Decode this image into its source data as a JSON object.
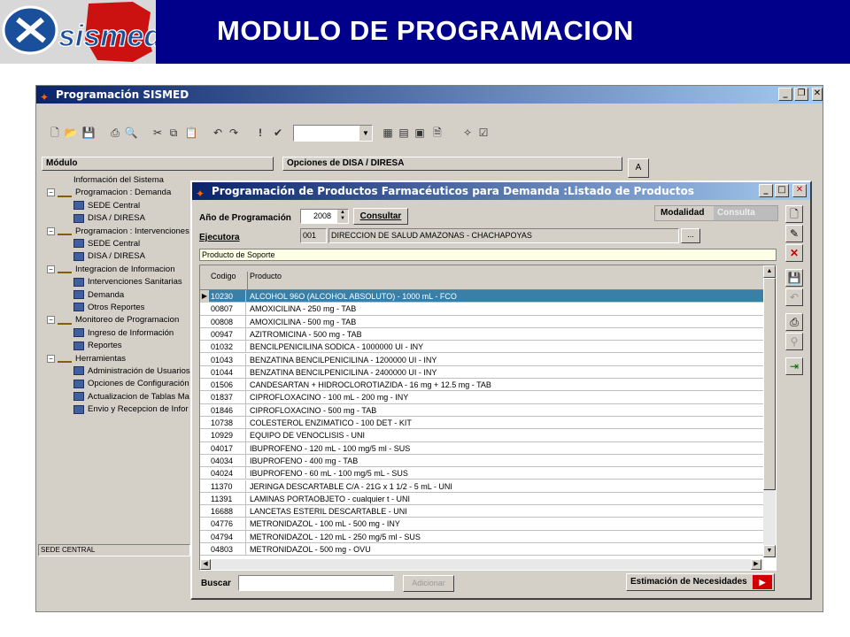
{
  "slide": {
    "title": "MODULO DE PROGRAMACION",
    "logo_text": "sismed"
  },
  "main_window": {
    "title": "Programación SISMED",
    "panel_left_header": "Módulo",
    "panel_right_header": "Opciones de DISA / DIRESA",
    "a_button": "A",
    "status_text": "SEDE CENTRAL",
    "tree": [
      {
        "label": "Información del Sistema",
        "level": 1
      },
      {
        "label": "Programacion : Demanda",
        "level": 0
      },
      {
        "label": "SEDE Central",
        "level": 2
      },
      {
        "label": "DISA / DIRESA",
        "level": 2
      },
      {
        "label": "Programacion : Intervenciones S",
        "level": 0
      },
      {
        "label": "SEDE Central",
        "level": 2
      },
      {
        "label": "DISA / DIRESA",
        "level": 2
      },
      {
        "label": "Integracion de Informacion",
        "level": 0
      },
      {
        "label": "Intervenciones Sanitarias",
        "level": 2
      },
      {
        "label": "Demanda",
        "level": 2
      },
      {
        "label": "Otros Reportes",
        "level": 2
      },
      {
        "label": "Monitoreo de Programacion",
        "level": 0
      },
      {
        "label": "Ingreso de Información",
        "level": 2
      },
      {
        "label": "Reportes",
        "level": 2
      },
      {
        "label": "Herramientas",
        "level": 0
      },
      {
        "label": "Administración de Usuarios",
        "level": 2
      },
      {
        "label": "Opciones de Configuración",
        "level": 2
      },
      {
        "label": "Actualizacion de Tablas Ma",
        "level": 2
      },
      {
        "label": "Envio y Recepcion de Infor",
        "level": 2
      }
    ]
  },
  "dialog": {
    "title": "Programación de Productos Farmacéuticos para Demanda :Listado de Productos",
    "year_label": "Año de Programación",
    "year_value": "2008",
    "consultar_label": "Consultar",
    "modalidad_label": "Modalidad",
    "modalidad_value": "Consulta",
    "ejecutora_label": "Ejecutora",
    "ejecutora_code": "001",
    "ejecutora_name": "DIRECCION DE SALUD AMAZONAS - CHACHAPOYAS",
    "browse_label": "...",
    "soporte_label": "Producto de Soporte",
    "col_codigo": "Codigo",
    "col_producto": "Producto",
    "buscar_label": "Buscar",
    "buscar_value": "",
    "adicionar_label": "Adicionar",
    "estimacion_label": "Estimación de Necesidades",
    "rows": [
      {
        "code": "10230",
        "product": "ALCOHOL 96O (ALCOHOL ABSOLUTO) - 1000 mL - FCO"
      },
      {
        "code": "00807",
        "product": "AMOXICILINA - 250 mg - TAB"
      },
      {
        "code": "00808",
        "product": "AMOXICILINA - 500 mg - TAB"
      },
      {
        "code": "00947",
        "product": "AZITROMICINA - 500 mg - TAB"
      },
      {
        "code": "01032",
        "product": "BENCILPENICILINA SODICA - 1000000 UI - INY"
      },
      {
        "code": "01043",
        "product": "BENZATINA BENCILPENICILINA - 1200000 UI - INY"
      },
      {
        "code": "01044",
        "product": "BENZATINA BENCILPENICILINA - 2400000 UI - INY"
      },
      {
        "code": "01506",
        "product": "CANDESARTAN + HIDROCLOROTIAZIDA - 16 mg + 12.5 mg - TAB"
      },
      {
        "code": "01837",
        "product": "CIPROFLOXACINO - 100 mL - 200 mg - INY"
      },
      {
        "code": "01846",
        "product": "CIPROFLOXACINO - 500 mg - TAB"
      },
      {
        "code": "10738",
        "product": "COLESTEROL ENZIMATICO - 100 DET - KIT"
      },
      {
        "code": "10929",
        "product": "EQUIPO DE VENOCLISIS - UNI"
      },
      {
        "code": "04017",
        "product": "IBUPROFENO - 120 mL - 100 mg/5 ml - SUS"
      },
      {
        "code": "04034",
        "product": "IBUPROFENO - 400 mg - TAB"
      },
      {
        "code": "04024",
        "product": "IBUPROFENO - 60 mL - 100 mg/5 mL - SUS"
      },
      {
        "code": "11370",
        "product": "JERINGA DESCARTABLE C/A - 21G x 1 1/2 - 5 mL - UNI"
      },
      {
        "code": "11391",
        "product": "LAMINAS PORTAOBJETO - cualquier t - UNI"
      },
      {
        "code": "16688",
        "product": "LANCETAS ESTERIL DESCARTABLE - UNI"
      },
      {
        "code": "04776",
        "product": "METRONIDAZOL - 100 mL - 500 mg - INY"
      },
      {
        "code": "04794",
        "product": "METRONIDAZOL - 120 mL - 250 mg/5 ml - SUS"
      },
      {
        "code": "04803",
        "product": "METRONIDAZOL - 500 mg - OVU"
      }
    ]
  }
}
